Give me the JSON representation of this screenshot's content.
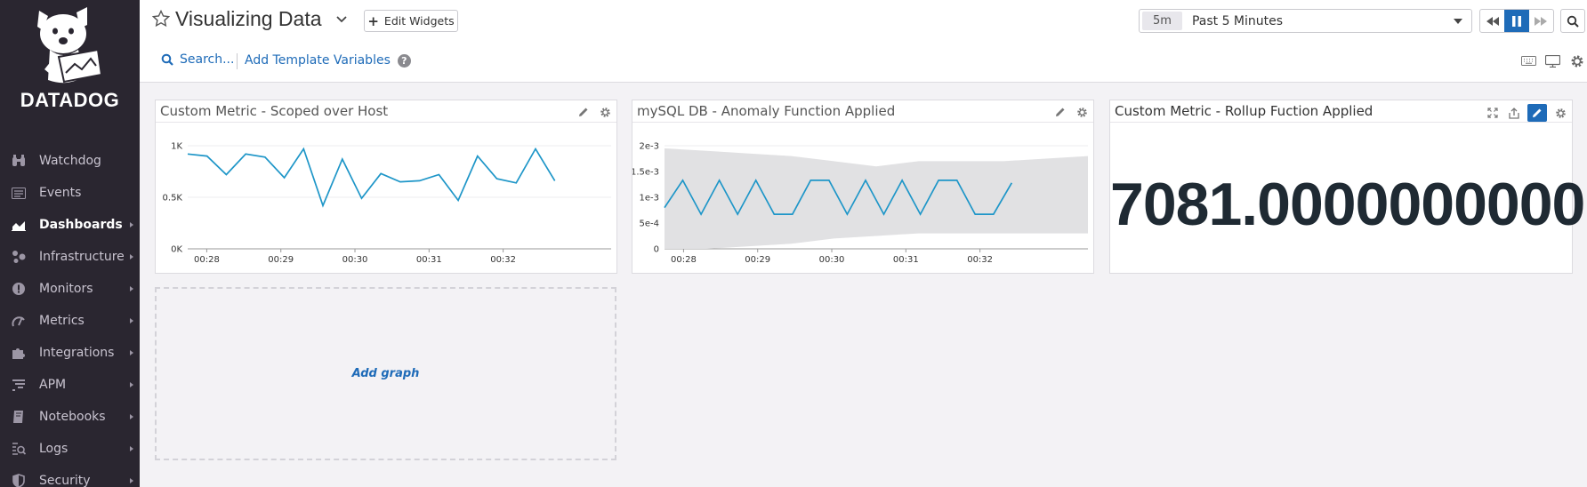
{
  "sidebar": {
    "brand": "DATADOG",
    "items": [
      {
        "label": "Watchdog",
        "icon": "binoculars-icon",
        "active": false,
        "has_arrow": false
      },
      {
        "label": "Events",
        "icon": "events-icon",
        "active": false,
        "has_arrow": false
      },
      {
        "label": "Dashboards",
        "icon": "dashboards-icon",
        "active": true,
        "has_arrow": true
      },
      {
        "label": "Infrastructure",
        "icon": "infrastructure-icon",
        "active": false,
        "has_arrow": true
      },
      {
        "label": "Monitors",
        "icon": "monitors-icon",
        "active": false,
        "has_arrow": true
      },
      {
        "label": "Metrics",
        "icon": "metrics-icon",
        "active": false,
        "has_arrow": true
      },
      {
        "label": "Integrations",
        "icon": "integrations-icon",
        "active": false,
        "has_arrow": true
      },
      {
        "label": "APM",
        "icon": "apm-icon",
        "active": false,
        "has_arrow": true
      },
      {
        "label": "Notebooks",
        "icon": "notebooks-icon",
        "active": false,
        "has_arrow": true
      },
      {
        "label": "Logs",
        "icon": "logs-icon",
        "active": false,
        "has_arrow": true
      },
      {
        "label": "Security",
        "icon": "security-icon",
        "active": false,
        "has_arrow": true
      }
    ]
  },
  "header": {
    "title": "Visualizing Data",
    "edit_widgets": "Edit Widgets",
    "search": "Search...",
    "template_vars": "Add Template Variables",
    "help": "?",
    "timeframe_short": "5m",
    "timeframe_label": "Past 5 Minutes"
  },
  "colors": {
    "accent": "#1e6bb8",
    "sidebar_bg": "#2a2630",
    "series_line": "#1e96c8",
    "anomaly_band": "#e1e1e3"
  },
  "widgets": [
    {
      "title": "Custom Metric - Scoped over Host",
      "chart_data": {
        "type": "line",
        "x": [
          "00:28",
          "00:29",
          "00:30",
          "00:31",
          "00:32"
        ],
        "ytick_labels": [
          "1K",
          "0.5K",
          "0K"
        ],
        "ylim": [
          0,
          1000
        ],
        "series": [
          {
            "values": [
              920,
              900,
              720,
              920,
              890,
              690,
              970,
              420,
              870,
              490,
              730,
              650,
              660,
              720,
              470,
              900,
              680,
              640,
              970,
              660
            ]
          }
        ]
      }
    },
    {
      "title": "mySQL DB - Anomaly Function Applied",
      "chart_data": {
        "type": "line",
        "x": [
          "00:28",
          "00:29",
          "00:30",
          "00:31",
          "00:32"
        ],
        "ytick_labels": [
          "2e-3",
          "1.5e-3",
          "1e-3",
          "5e-4",
          "0"
        ],
        "ylim": [
          0,
          0.002
        ],
        "band": {
          "upper": [
            0.00195,
            0.0019,
            0.00185,
            0.0018,
            0.0017,
            0.0016,
            0.0017,
            0.0017,
            0.0017,
            0.00175,
            0.0018
          ],
          "lower": [
            0.0,
            0.0,
            5e-05,
            0.0001,
            0.0002,
            0.00025,
            0.0003,
            0.0003,
            0.0003,
            0.0003,
            0.0003
          ]
        },
        "series": [
          {
            "values": [
              0.0008,
              0.00133,
              0.00067,
              0.00133,
              0.00067,
              0.00133,
              0.00067,
              0.00067,
              0.00133,
              0.00133,
              0.00067,
              0.00133,
              0.00067,
              0.00133,
              0.00067,
              0.00133,
              0.00133,
              0.00067,
              0.00067,
              0.00128
            ]
          }
        ]
      }
    },
    {
      "title": "Custom Metric - Rollup Fuction Applied",
      "value": "7081.0000000000"
    }
  ],
  "add_graph": "Add graph"
}
